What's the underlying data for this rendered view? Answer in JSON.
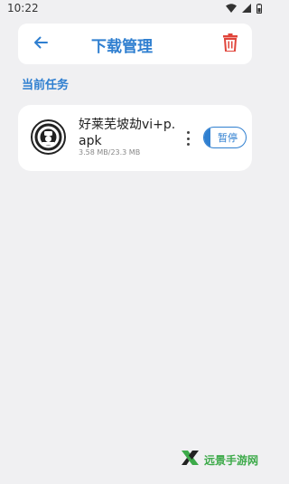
{
  "status_bar": {
    "time": "10:22"
  },
  "header": {
    "title": "下载管理"
  },
  "section": {
    "label": "当前任务"
  },
  "tasks": [
    {
      "file_name": "好莱芜坡劫vi+p.apk",
      "size_text": "3.58 MB/23.3 MB",
      "progress": 0.154,
      "action_label": "暂停"
    }
  ],
  "watermark": {
    "text": "远景手游网"
  },
  "colors": {
    "accent": "#2f7fd0",
    "delete": "#e0443a",
    "background": "#f0f0f2"
  }
}
